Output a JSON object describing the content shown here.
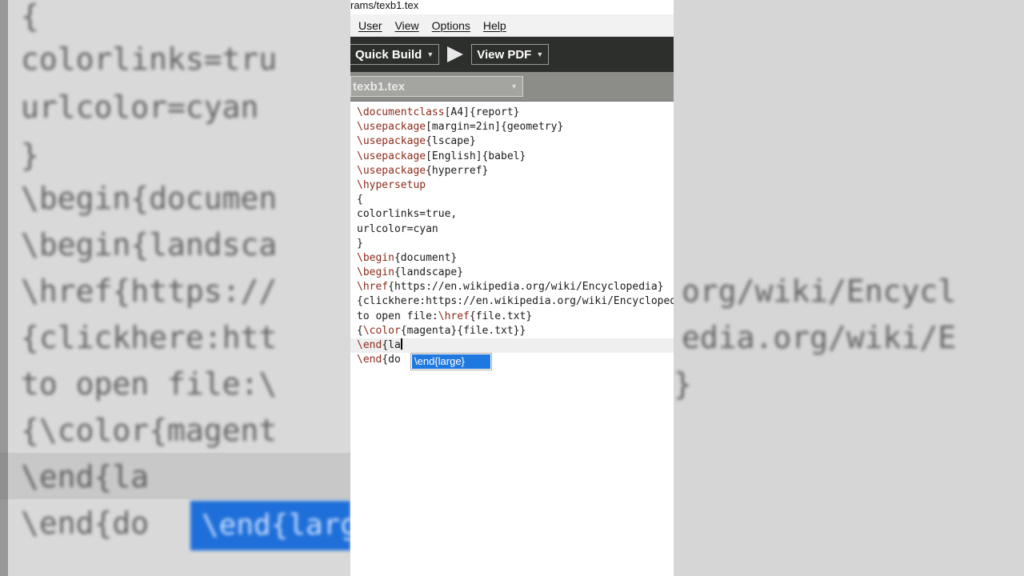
{
  "window": {
    "title": "rams/texb1.tex"
  },
  "menu": [
    "User",
    "View",
    "Options",
    "Help"
  ],
  "toolbar": {
    "quick_build": "Quick Build",
    "view_pdf": "View PDF"
  },
  "file_tab": {
    "name": "texb1.tex"
  },
  "editor_lines": [
    "\\documentclass[A4]{report}",
    "\\usepackage[margin=2in]{geometry}",
    "\\usepackage{lscape}",
    "\\usepackage[English]{babel}",
    "\\usepackage{hyperref}",
    "\\hypersetup",
    "{",
    "colorlinks=true,",
    "urlcolor=cyan",
    "}",
    "\\begin{document}",
    "\\begin{landscape}",
    "\\href{https://en.wikipedia.org/wiki/Encyclopedia}",
    "{clickhere:https://en.wikipedia.org/wiki/Encyclopedia}",
    "to open file:\\href{file.txt}",
    "{\\color{magenta}{file.txt}}",
    "\\end{la",
    "\\end{do"
  ],
  "autocomplete": {
    "suggestion": "\\end{large}"
  },
  "background_zoom": {
    "lines": [
      "{",
      "colorlinks=tru",
      "urlcolor=cyan",
      "}",
      "\\begin{documen",
      "\\begin{landsca",
      "\\href{https://",
      "{clickhere:htt",
      "to open file:\\",
      "{\\color{magent",
      "\\end{la",
      "\\end{do"
    ],
    "right_lines": [
      "",
      "",
      "",
      "",
      "",
      "",
      "org/wiki/Encycl",
      "edia.org/wiki/E",
      "}",
      "",
      "",
      ""
    ],
    "popup": "\\end{larg"
  }
}
